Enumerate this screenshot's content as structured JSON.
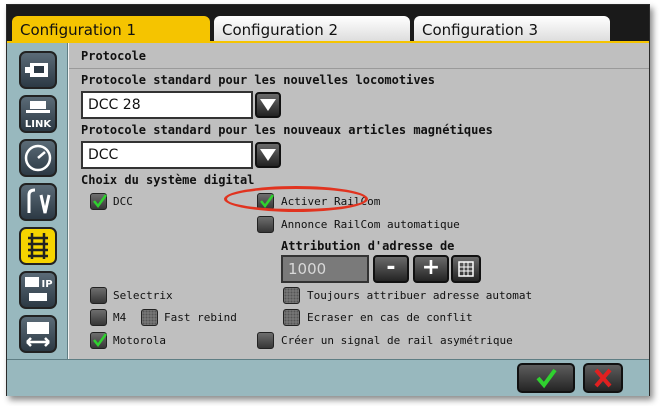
{
  "tabs": [
    {
      "label": "Configuration 1",
      "active": true
    },
    {
      "label": "Configuration 2",
      "active": false
    },
    {
      "label": "Configuration 3",
      "active": false
    }
  ],
  "sidebar": {
    "items": [
      {
        "icon": "locomotive-icon"
      },
      {
        "icon": "link-icon",
        "label": "LINK"
      },
      {
        "icon": "gauge-icon"
      },
      {
        "icon": "signal-icon"
      },
      {
        "icon": "track-icon",
        "active": true
      },
      {
        "icon": "ip-network-icon",
        "label": "IP"
      },
      {
        "icon": "booster-icon"
      }
    ]
  },
  "panel": {
    "title": "Protocole",
    "loco_label": "Protocole standard pour les nouvelles locomotives",
    "loco_value": "DCC 28",
    "acc_label": "Protocole standard pour les nouveaux articles magnétiques",
    "acc_value": "DCC",
    "digital_label": "Choix du système digital",
    "checkboxes": {
      "dcc": {
        "label": "DCC",
        "checked": true
      },
      "railcom": {
        "label": "Activer RailCom",
        "checked": true
      },
      "railcom_auto": {
        "label": "Annonce RailCom automatique",
        "checked": false
      },
      "selectrix": {
        "label": "Selectrix",
        "checked": false
      },
      "m4": {
        "label": "M4",
        "checked": false
      },
      "fast_rebind": {
        "label": "Fast rebind",
        "checked": false
      },
      "motorola": {
        "label": "Motorola",
        "checked": true
      },
      "always_assign": {
        "label": "Toujours attribuer adresse automat",
        "checked": false
      },
      "overwrite": {
        "label": "Ecraser en cas de conflit",
        "checked": false
      },
      "asym_signal": {
        "label": "Créer un signal de rail asymétrique",
        "checked": false
      }
    },
    "address_label": "Attribution d'adresse de",
    "address_value": "1000",
    "minus_label": "-",
    "plus_label": "+"
  },
  "colors": {
    "tab_active": "#f5c400",
    "sidebar": "#98b8be",
    "panel": "#bfbfbf",
    "highlight_ellipse": "#e1331f",
    "ok_check": "#2fd12f",
    "cancel_x": "#e02020"
  }
}
